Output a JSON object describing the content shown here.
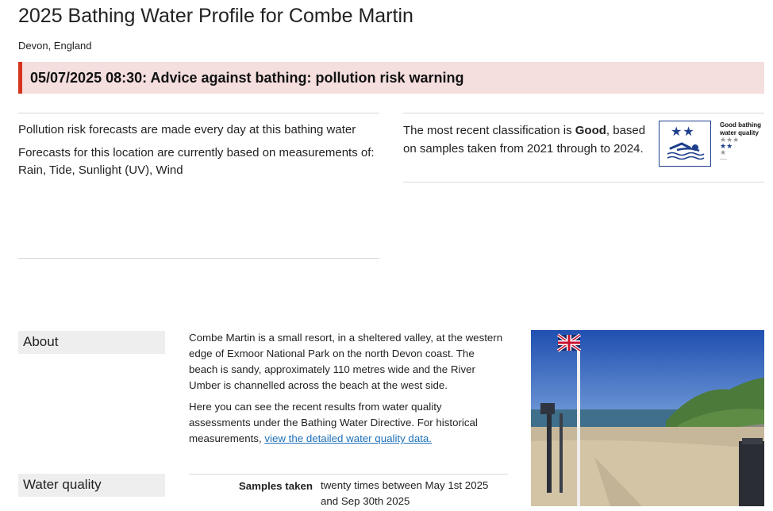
{
  "page": {
    "title": "2025 Bathing Water Profile for Combe Martin",
    "subtitle": "Devon, England"
  },
  "warning": {
    "text": "05/07/2025 08:30: Advice against bathing: pollution risk warning"
  },
  "forecast": {
    "line1": "Pollution risk forecasts are made every day at this bathing water",
    "line2": "Forecasts for this location are currently based on measurements of:",
    "line3": "Rain, Tide, Sunlight (UV), Wind"
  },
  "classification": {
    "prefix": "The most recent classification is ",
    "grade": "Good",
    "suffix": ", based on samples taken from 2021 through to 2024.",
    "badge_icon": "good-quality-swimmer-icon",
    "badge_stars": "★★",
    "legend_title": "Good bathing water quality",
    "legend_rows": [
      "★★★",
      "★★",
      "★",
      "—"
    ]
  },
  "sections": {
    "about_label": "About",
    "water_quality_label": "Water quality"
  },
  "about": {
    "para1": "Combe Martin is a small resort, in a sheltered valley, at the western edge of Exmoor National Park on the north Devon coast. The beach is sandy, approximately 110 metres wide and the River Umber is channelled across the beach at the west side.",
    "para2_text": "Here you can see the recent results from water quality assessments under the Bathing Water Directive. For historical measurements, ",
    "para2_link": "view the detailed water quality data."
  },
  "water_quality": {
    "samples_label": "Samples taken",
    "samples_value": "twenty times between May 1st 2025 and Sep 30th 2025"
  },
  "colors": {
    "warning_bg": "#f4dede",
    "warning_bar": "#d4351c",
    "badge_blue": "#1d3f8c",
    "link": "#1d70b8"
  }
}
